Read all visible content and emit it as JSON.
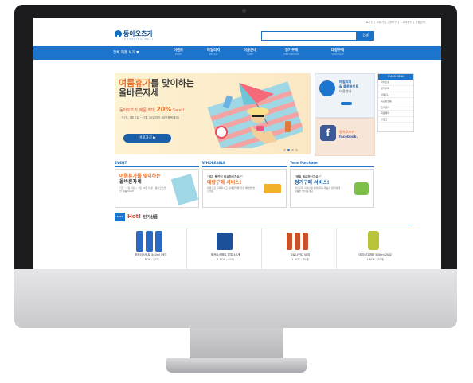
{
  "util_links": "로그인 | 회원가입 | 장바구니 | 고객센터 | 통합검색",
  "logo": {
    "name": "동아오츠카",
    "sub": "SHOPPING MALL"
  },
  "search": {
    "button": "검색",
    "placeholder": ""
  },
  "nav": {
    "all_label": "전체 제품 보기 ▼",
    "items": [
      {
        "label": "이벤트",
        "sub": "EVENT"
      },
      {
        "label": "마일리지",
        "sub": "MILEAGE"
      },
      {
        "label": "이용안내",
        "sub": "GUIDE"
      },
      {
        "label": "정기구매",
        "sub": "TERM PURCHASE"
      },
      {
        "label": "대량구매",
        "sub": "WHOLESALE"
      }
    ]
  },
  "hero": {
    "line1": "여름휴가",
    "line1b": "를 맞이하는",
    "line2": "올바른자세",
    "sale_prefix": "동아오츠카 제품 최대",
    "sale_value": "20%",
    "sale_suffix": "Sale!!",
    "period": "· 기간 : 7월 2일 ~ 7월 29일까지 (일부품목제외)",
    "button": "바로가기 ▶"
  },
  "side_ad1": {
    "title": "마일리지",
    "title2": "& 블루포인트",
    "title3": "이용안내"
  },
  "side_ad2": {
    "title": "동아오츠카",
    "title2": "facebook."
  },
  "right_panel": {
    "header": "QUICK MENU",
    "items": [
      "마이쇼핑",
      "정기구매",
      "장바구니",
      "최근본상품",
      "고객센터",
      "회원혜택",
      "블로그"
    ]
  },
  "sections": [
    {
      "title": "EVENT",
      "big1": "여름휴가를 맞이하는",
      "big2": "올바른자세",
      "small": "기간 : 7월 2일 ~ 7월 29일 대상 : 동아오츠카 전 제품 SALE"
    },
    {
      "title": "WHOLESALE",
      "big1": "\"많은 물건이 필요하신가요?\"",
      "big2": "대량구매 서비스!",
      "small": "대량으로 구매하시고 구매금액별 할인 혜택을 받으세요"
    },
    {
      "title": "Term Purchase",
      "big1": "\"매일 필요하신가요?\"",
      "big2": "정기구매 서비스!",
      "small": "정기구매 서비스를 통해 자동 배송과 편리하게 상품을 받아보세요"
    }
  ],
  "hot": {
    "best": "BEST",
    "title": "Hot!",
    "subtitle": "인기상품"
  },
  "products": [
    {
      "name": "포카리스웨트 340ml PET",
      "qty": "1 BOX : 20개",
      "color": "#2a6ac2"
    },
    {
      "name": "포카리스웨트 분말 40개",
      "qty": "1 BOX : 40개",
      "color": "#1d4f9b"
    },
    {
      "name": "오로나민C 30입",
      "qty": "1 BOX : 30개",
      "color": "#c7512a"
    },
    {
      "name": "데미소다애플 500ml 20입",
      "qty": "1 BOX : 20개",
      "color": "#b9c43a"
    }
  ]
}
